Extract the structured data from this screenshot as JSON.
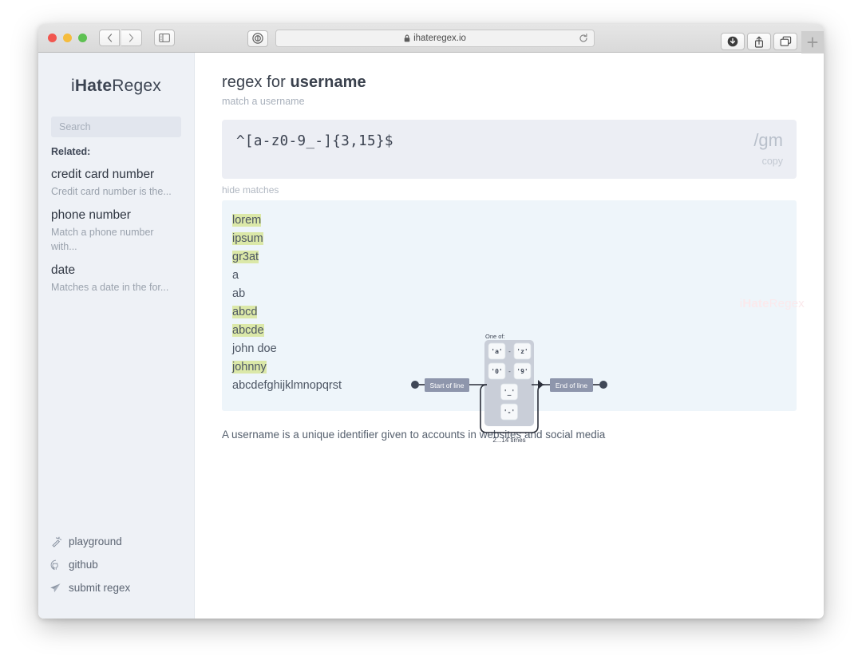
{
  "browser": {
    "url": "ihateregex.io",
    "lock_icon": "lock-icon",
    "reload_icon": "reload-icon",
    "back_icon": "chevron-left-icon",
    "forward_icon": "chevron-right-icon",
    "sidebar_toggle_icon": "sidebar-toggle-icon",
    "privacy_icon": "privacy-report-icon",
    "downloads_icon": "downloads-icon",
    "share_icon": "share-icon",
    "tabs_icon": "tab-overview-icon",
    "newtab_label": "+"
  },
  "sidebar": {
    "brand_prefix": "i",
    "brand_bold": "Hate",
    "brand_suffix": "Regex",
    "search_placeholder": "Search",
    "related_label": "Related:",
    "related": [
      {
        "title": "credit card number",
        "desc": "Credit card number is the..."
      },
      {
        "title": "phone number",
        "desc": "Match a phone number with..."
      },
      {
        "title": "date",
        "desc": "Matches a date in the for..."
      }
    ],
    "links": [
      {
        "label": "playground",
        "icon": "magic-wand-icon"
      },
      {
        "label": "github",
        "icon": "github-icon"
      },
      {
        "label": "submit regex",
        "icon": "paper-plane-icon"
      }
    ]
  },
  "main": {
    "title_prefix": "regex for ",
    "title_bold": "username",
    "subtitle": "match a username",
    "regex": "^[a-z0-9_-]{3,15}$",
    "flags": "/gm",
    "copy_label": "copy",
    "toggle_matches_label": "hide matches",
    "description": "A username is a unique identifier given to accounts in websites and social media",
    "watermark_prefix": "i",
    "watermark_bold": "Hate",
    "watermark_suffix": "Regex",
    "matches": [
      {
        "text": "lorem",
        "matched": true
      },
      {
        "text": "ipsum",
        "matched": true
      },
      {
        "text": "gr3at",
        "matched": true
      },
      {
        "text": "a",
        "matched": false
      },
      {
        "text": "ab",
        "matched": false
      },
      {
        "text": "abcd",
        "matched": true
      },
      {
        "text": "abcde",
        "matched": true
      },
      {
        "text": "john doe",
        "matched": false
      },
      {
        "text": "johnny",
        "matched": true
      },
      {
        "text": "abcdefghijklmnopqrst",
        "matched": false
      }
    ]
  },
  "diagram": {
    "start_label": "Start of line",
    "end_label": "End of line",
    "one_of_label": "One of:",
    "ranges": [
      {
        "from": "'a'",
        "dash": "-",
        "to": "'z'"
      },
      {
        "from": "'0'",
        "dash": "-",
        "to": "'9'"
      }
    ],
    "singles": [
      "'_'",
      "'-'"
    ],
    "repeat_label": "2...14 times"
  },
  "colors": {
    "sidebar_bg": "#eef1f6",
    "regex_box_bg": "#eceef4",
    "matches_bg": "#eef5fa",
    "highlight": "#dbe8a8",
    "diagram_label_bg": "#8e96ac",
    "watermark": "#fbe9ec"
  }
}
